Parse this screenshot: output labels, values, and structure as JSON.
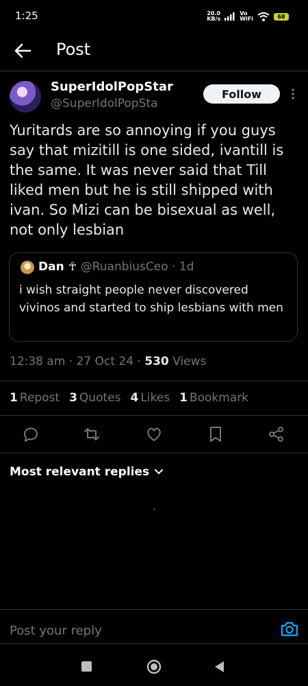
{
  "status_bar": {
    "time": "1:25",
    "net_speed_value": "20.0",
    "net_speed_unit": "KB/s",
    "vowifi_top": "Vo",
    "vowifi_bottom": "WiFi",
    "battery": "68"
  },
  "header": {
    "title": "Post"
  },
  "post": {
    "display_name": "SuperIdolPopStar",
    "handle": "@SuperIdolPopSta",
    "follow_label": "Follow",
    "text": "Yuritards are so annoying if you guys say that mizitill is one sided, ivantill is the same. It was never said that Till liked men but he is still shipped with ivan. So Mizi can be bisexual as well, not only lesbian",
    "quote": {
      "name": "Dan ☥",
      "meta": "@RuanbiusCeo · 1d",
      "text": "i wish straight people never discovered vivinos and started to ship lesbians with men"
    },
    "timestamp": "12:38 am · 27 Oct 24 · ",
    "views_count": "530",
    "views_label": " Views",
    "stats": [
      {
        "count": "1",
        "label": "Repost"
      },
      {
        "count": "3",
        "label": "Quotes"
      },
      {
        "count": "4",
        "label": "Likes"
      },
      {
        "count": "1",
        "label": "Bookmark"
      }
    ]
  },
  "replies": {
    "sort_label": "Most relevant replies"
  },
  "reply_box": {
    "placeholder": "Post your reply"
  },
  "colors": {
    "background": "#000000",
    "text": "#e7e9ea",
    "muted": "#71767b",
    "accent": "#1d9bf0",
    "divider": "#2f3336"
  },
  "icons": [
    "back-arrow-icon",
    "more-icon",
    "reply-icon",
    "repost-icon",
    "like-icon",
    "bookmark-icon",
    "share-icon",
    "chevron-down-icon",
    "camera-icon"
  ]
}
